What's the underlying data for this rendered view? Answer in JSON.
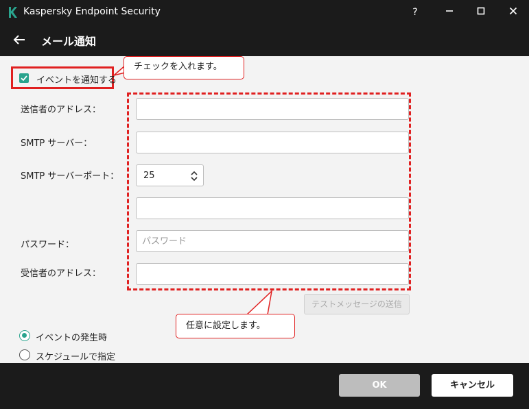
{
  "window": {
    "title": "Kaspersky Endpoint Security",
    "help": "?",
    "minimize": "—",
    "maximize": "☐",
    "close": "✕"
  },
  "header": {
    "title": "メール通知"
  },
  "notify": {
    "label": "イベントを通知する",
    "checked": true
  },
  "fields": {
    "sender_label": "送信者のアドレス：",
    "smtp_server_label": "SMTP サーバー：",
    "smtp_port_label": "SMTP サーバーポート：",
    "smtp_port_value": "25",
    "password_label": "パスワード：",
    "password_placeholder": "パスワード",
    "recipient_label": "受信者のアドレス："
  },
  "test_button": "テストメッセージの送信",
  "callouts": {
    "check_note": "チェックを入れます。",
    "optional_note": "任意に設定します。"
  },
  "schedule": {
    "on_event": "イベントの発生時",
    "by_schedule": "スケジュールで指定",
    "selected": "on_event"
  },
  "footer": {
    "ok": "OK",
    "cancel": "キャンセル"
  },
  "colors": {
    "accent": "#2aa48e",
    "highlight": "#e02020",
    "dark_bar": "#1b1b1b",
    "background": "#f3f3f3"
  }
}
